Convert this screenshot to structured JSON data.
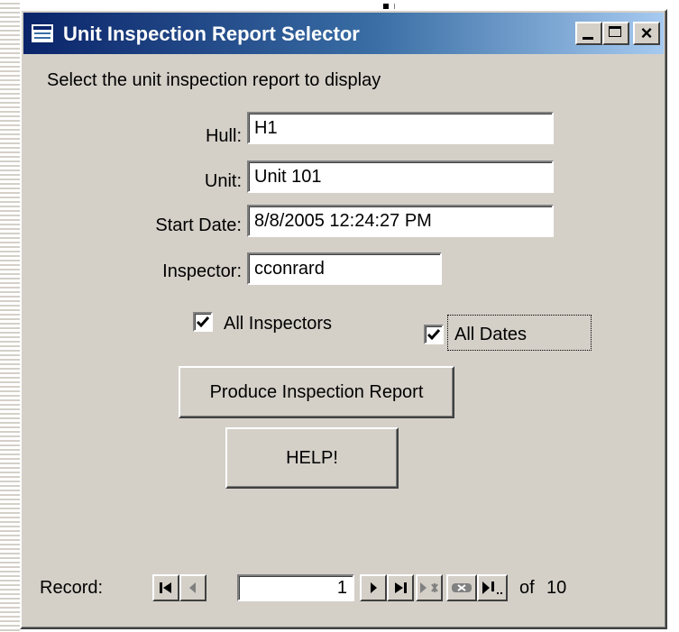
{
  "window": {
    "title": "Unit Inspection Report Selector"
  },
  "form": {
    "instruction": "Select the unit inspection report to display",
    "hull_label": "Hull:",
    "hull_value": "H1",
    "unit_label": "Unit:",
    "unit_value": "Unit 101",
    "start_date_label": "Start Date:",
    "start_date_value": "8/8/2005 12:24:27 PM",
    "inspector_label": "Inspector:",
    "inspector_value": "cconrard",
    "all_inspectors_label": "All Inspectors",
    "all_inspectors_checked": true,
    "all_dates_label": "All Dates",
    "all_dates_checked": true,
    "produce_button": "Produce Inspection Report",
    "help_button": "HELP!"
  },
  "navigation": {
    "record_label": "Record:",
    "current_record": "1",
    "of_label": "of",
    "total_records": "10"
  },
  "colors": {
    "window_bg": "#d4d0c8",
    "title_start": "#0a246a",
    "title_end": "#a6caf0"
  }
}
